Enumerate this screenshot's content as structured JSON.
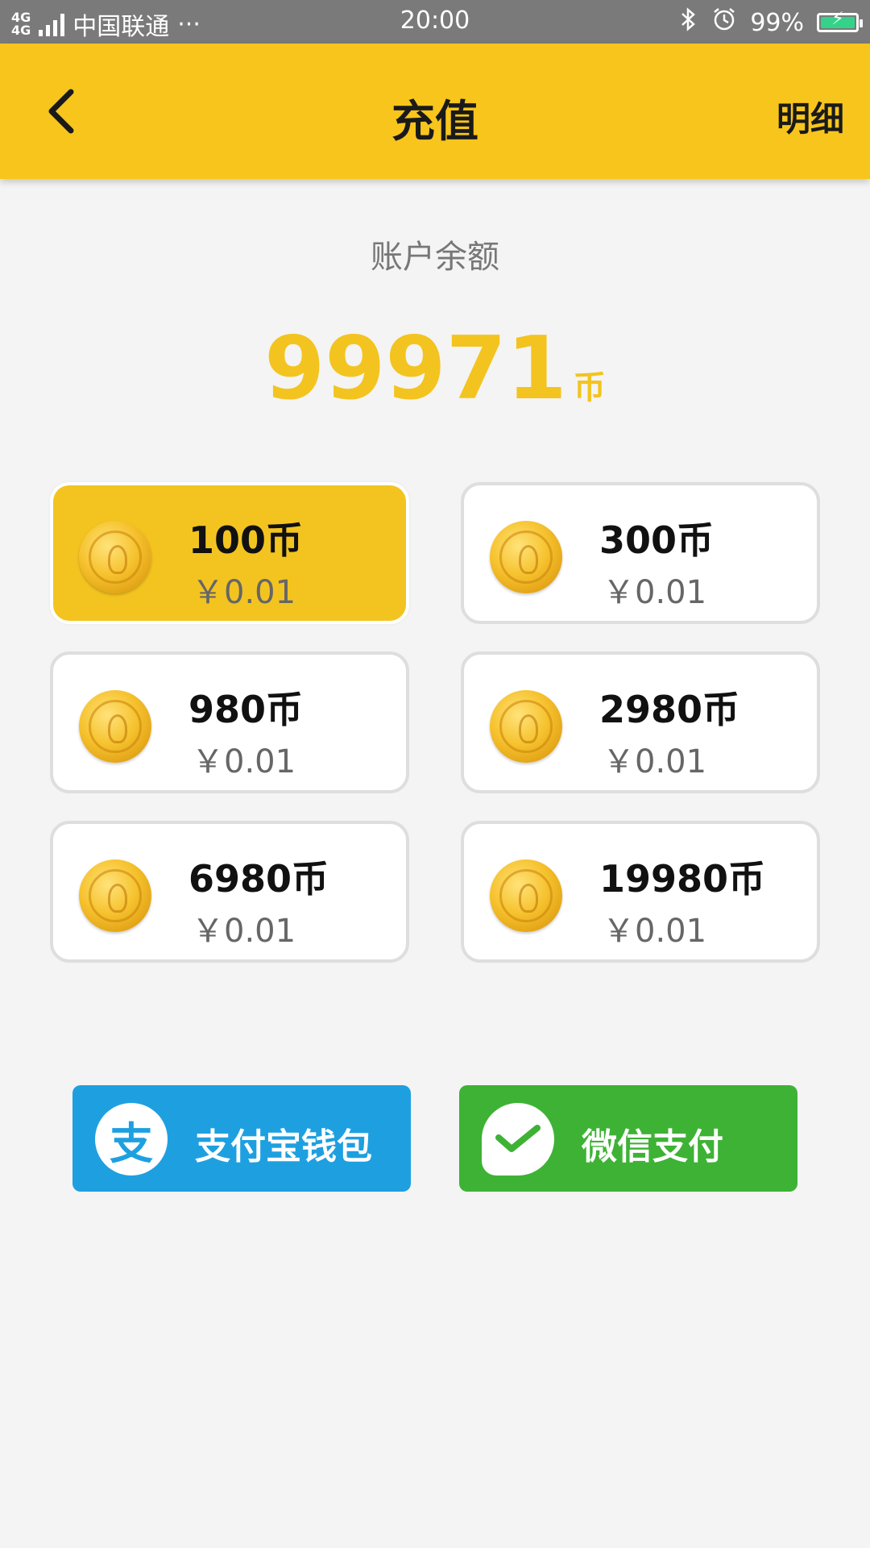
{
  "status_bar": {
    "network": [
      "4G",
      "4G"
    ],
    "carrier": "中国联通",
    "more": "···",
    "time": "20:00",
    "battery": "99%",
    "battery_level": 0.99
  },
  "header": {
    "title": "充值",
    "detail_label": "明细"
  },
  "balance": {
    "label": "账户余额",
    "amount": "99971",
    "unit": "币"
  },
  "packages": [
    {
      "coins": "100币",
      "price": "￥0.01",
      "selected": true
    },
    {
      "coins": "300币",
      "price": "￥0.01",
      "selected": false
    },
    {
      "coins": "980币",
      "price": "￥0.01",
      "selected": false
    },
    {
      "coins": "2980币",
      "price": "￥0.01",
      "selected": false
    },
    {
      "coins": "6980币",
      "price": "￥0.01",
      "selected": false
    },
    {
      "coins": "19980币",
      "price": "￥0.01",
      "selected": false
    }
  ],
  "payment": {
    "alipay_label": "支付宝钱包",
    "alipay_icon_char": "支",
    "wechat_label": "微信支付"
  },
  "colors": {
    "accent": "#f8c51c",
    "alipay": "#1ea0e0",
    "wechat": "#3eb235"
  },
  "icons": {
    "back": "chevron-left-icon",
    "bluetooth": "bluetooth-icon",
    "alarm": "alarm-icon",
    "coin": "coin-icon"
  }
}
